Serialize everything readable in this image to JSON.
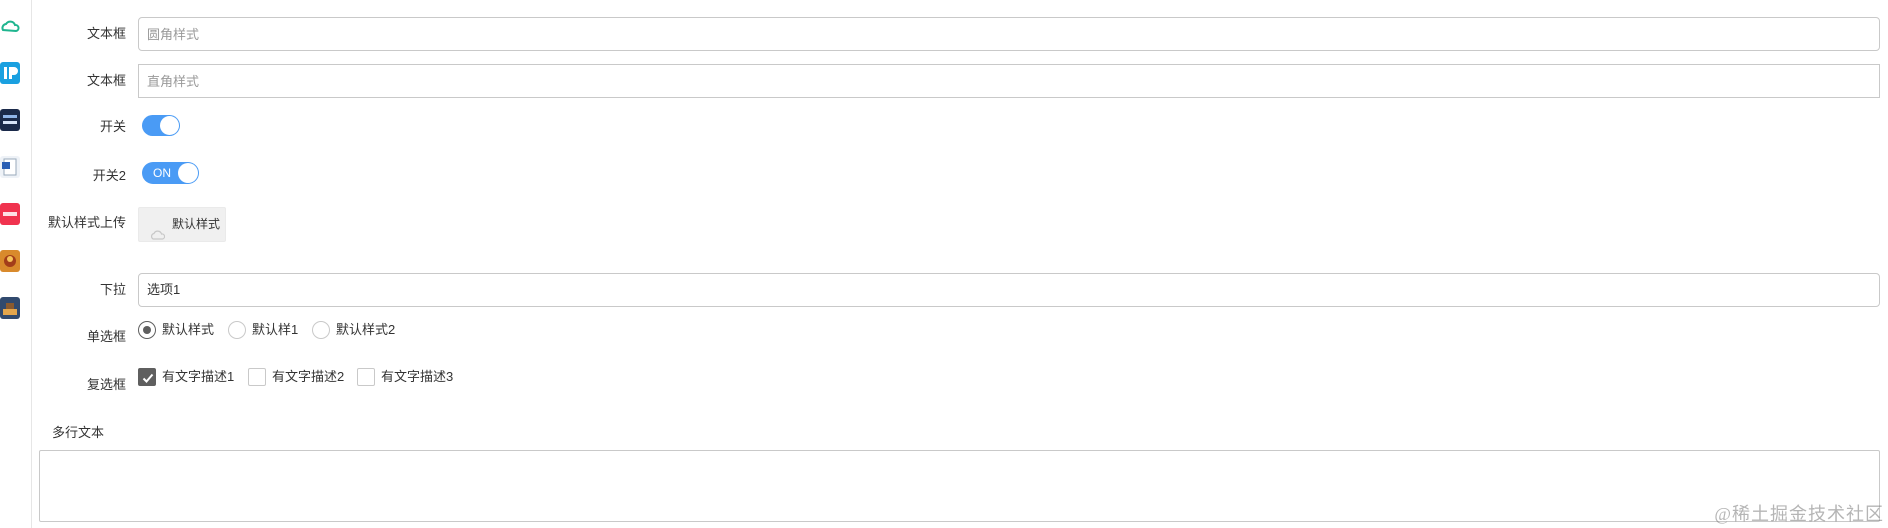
{
  "form": {
    "text_round": {
      "label": "文本框",
      "placeholder": "圆角样式",
      "value": ""
    },
    "text_square": {
      "label": "文本框",
      "placeholder": "直角样式",
      "value": ""
    },
    "switch1": {
      "label": "开关",
      "checked": true
    },
    "switch2": {
      "label": "开关2",
      "state_text": "ON",
      "checked": true
    },
    "upload": {
      "label": "默认样式上传",
      "button_label": "默认样式",
      "icon": "cloud-upload-icon"
    },
    "dropdown": {
      "label": "下拉",
      "selected": "选项1",
      "icon": "chevron-down-icon"
    },
    "radio": {
      "label": "单选框",
      "options": [
        {
          "label": "默认样式",
          "checked": true
        },
        {
          "label": "默认样1",
          "checked": false
        },
        {
          "label": "默认样式2",
          "checked": false
        }
      ]
    },
    "checkbox": {
      "label": "复选框",
      "options": [
        {
          "label": "有文字描述1",
          "checked": true
        },
        {
          "label": "有文字描述2",
          "checked": false
        },
        {
          "label": "有文字描述3",
          "checked": false
        }
      ]
    },
    "textarea": {
      "label": "多行文本",
      "value": ""
    }
  },
  "sidebar": {
    "apps": [
      {
        "name": "cloud-app-icon"
      },
      {
        "name": "ip-app-icon"
      },
      {
        "name": "chat-app-icon"
      },
      {
        "name": "word-doc-icon"
      },
      {
        "name": "red-app-icon"
      },
      {
        "name": "game-app-icon"
      },
      {
        "name": "game2-app-icon"
      }
    ]
  },
  "watermark": "@稀土掘金技术社区",
  "colors": {
    "accent": "#4a9bf5",
    "checked": "#5f5f5f",
    "border": "#c9c9c9",
    "placeholder": "#9a9a9a"
  }
}
